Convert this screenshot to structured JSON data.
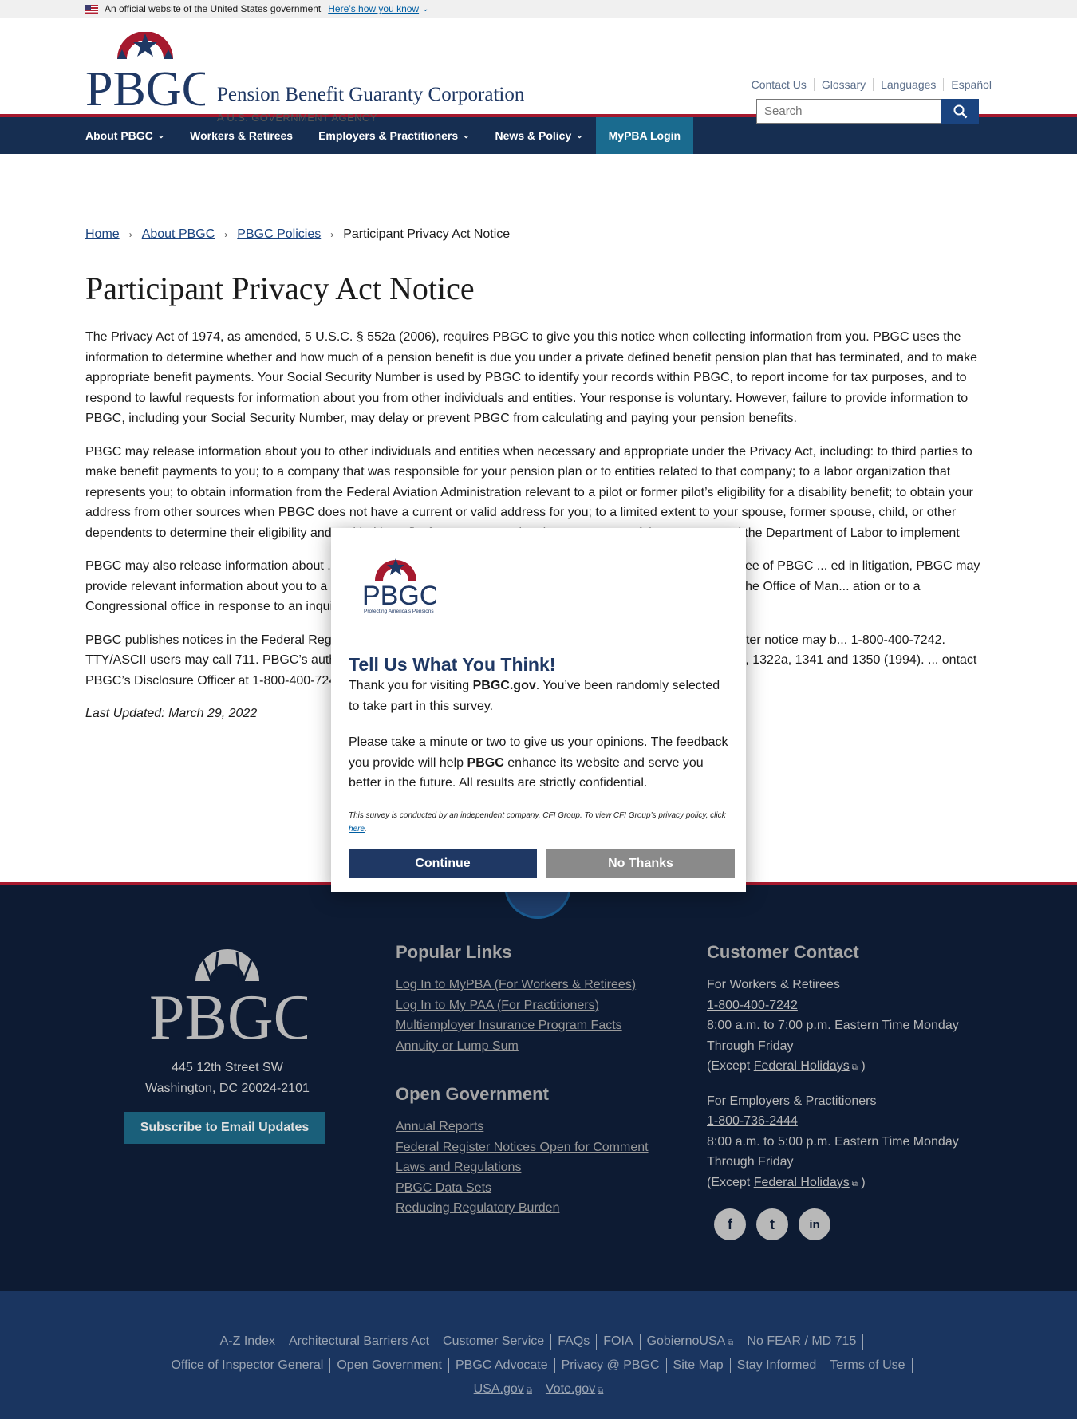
{
  "gov_banner": {
    "text": "An official website of the United States government",
    "how_link": "Here’s how you know"
  },
  "header": {
    "agency_name": "Pension Benefit Guaranty Corporation",
    "agency_sub": "A U.S. GOVERNMENT AGENCY",
    "util_links": [
      "Contact Us",
      "Glossary",
      "Languages",
      "Español"
    ],
    "search_placeholder": "Search"
  },
  "nav": {
    "items": [
      {
        "label": "About PBGC",
        "dropdown": true
      },
      {
        "label": "Workers & Retirees",
        "dropdown": false
      },
      {
        "label": "Employers & Practitioners",
        "dropdown": true
      },
      {
        "label": "News & Policy",
        "dropdown": true
      },
      {
        "label": "MyPBA Login",
        "dropdown": false
      }
    ]
  },
  "breadcrumb": [
    "Home",
    "About PBGC",
    "PBGC Policies",
    "Participant Privacy Act Notice"
  ],
  "page": {
    "title": "Participant Privacy Act Notice",
    "paragraphs": [
      "The Privacy Act of 1974, as amended, 5 U.S.C. § 552a (2006), requires PBGC to give you this notice when collecting information from you. PBGC uses the information to determine whether and how much of a pension benefit is due you under a private defined benefit pension plan that has terminated, and to make appropriate benefit payments. Your Social Security Number is used by PBGC to identify your records within PBGC, to report income for tax purposes, and to respond to lawful requests for information about you from other individuals and entities. Your response is voluntary. However, failure to provide information to PBGC, including your Social Security Number, may delay or prevent PBGC from calculating and paying your pension benefits.",
      "PBGC may release information about you to other individuals and entities when necessary and appropriate under the Privacy Act, including: to third parties to make benefit payments to you; to a company that was responsible for your pension plan or to entities related to that company; to a labor organization that represents you; to obtain information from the Federal Aviation Administration relevant to a pilot or former pilot’s eligibility for a disability benefit; to obtain your address from other sources when PBGC does not have a current or valid address for you; to a limited extent to your spouse, former spouse, child, or other dependents to determine their eligibility and entitled benefits from PBGC; and to the Department of the Treasury and the Department of Labor to implement",
      "PBGC may also release information about ... aware of a possible violation of civil or criminal law. If PBGC, an employee of PBGC ... ed in litigation, PBGC may provide relevant information about you to a court ... esents PBGC. PBGC may also provide information about you to the Office of Man... ation or to a Congressional office in response to an inquiry that office makes a",
      "PBGC publishes notices in the Federal Register ... made available to others. A copy of the most recent Federal Register notice may b... 1-800-400-7242. TTY/ASCII users may call 711. PBGC’s authority to collect inform... 29 U.S.C. §§ 1055, 1056(d)(3), 1302, 1321, 1322, 1322a, 1341 and 1350 (1994). ... ontact PBGC’s Disclosure Officer at 1-800-400-7242 extension 4040."
    ],
    "last_updated": "Last Updated: March 29, 2022"
  },
  "footer": {
    "address_line1": "445 12th Street SW",
    "address_line2": "Washington, DC 20024-2101",
    "subscribe": "Subscribe to Email Updates",
    "popular_links_title": "Popular Links",
    "popular_links": [
      "Log In to MyPBA (For Workers & Retirees)",
      "Log In to My PAA (For Practitioners)",
      "Multiemployer Insurance Program Facts",
      "Annuity or Lump Sum"
    ],
    "open_gov_title": "Open Government",
    "open_gov_links": [
      "Annual Reports",
      "Federal Register Notices Open for Comment",
      "Laws and Regulations",
      "PBGC Data Sets",
      "Reducing Regulatory Burden"
    ],
    "contact_title": "Customer Contact",
    "contact_workers_label": "For Workers & Retirees",
    "contact_workers_phone": "1-800-400-7242",
    "contact_workers_hours": "8:00 a.m. to 7:00 p.m. Eastern Time Monday Through Friday",
    "contact_employers_label": "For Employers & Practitioners",
    "contact_employers_phone": "1-800-736-2444",
    "contact_employers_hours": "8:00 a.m. to 5:00 p.m. Eastern Time Monday Through Friday",
    "except_prefix": "(Except ",
    "except_link": "Federal Holidays",
    "except_suffix": " )",
    "social": [
      {
        "name": "facebook-icon",
        "glyph": "f"
      },
      {
        "name": "twitter-icon",
        "glyph": "t"
      },
      {
        "name": "linkedin-icon",
        "glyph": "in"
      }
    ]
  },
  "bottom_links": {
    "row1": [
      "A-Z Index",
      "Architectural Barriers Act",
      "Customer Service",
      "FAQs",
      "FOIA",
      "GobiernoUSA",
      "No FEAR / MD 715"
    ],
    "row2": [
      "Office of Inspector General",
      "Open Government",
      "PBGC Advocate",
      "Privacy @ PBGC",
      "Site Map",
      "Stay Informed",
      "Terms of Use"
    ],
    "row3": [
      "USA.gov",
      "Vote.gov"
    ]
  },
  "modal": {
    "logo_tagline": "Protecting America’s Pensions",
    "title": "Tell Us What You Think!",
    "body1_pre": "Thank you for visiting ",
    "body1_bold": "PBGC.gov",
    "body1_post": ". You’ve been randomly selected to take part in this survey.",
    "body2_pre": "Please take a minute or two to give us your opinions. The feedback you provide will help ",
    "body2_bold": "PBGC",
    "body2_post": " enhance its website and serve you better in the future. All results are strictly confidential.",
    "fine_print": "This survey is conducted by an independent company, CFI Group. To view CFI Group’s privacy policy, click ",
    "fine_link": "here",
    "fine_end": ".",
    "continue_label": "Continue",
    "no_thanks_label": "No Thanks"
  },
  "colors": {
    "navy": "#162e51",
    "brand_red": "#a6192e",
    "link_blue": "#1a4480",
    "modal_title": "#1f3864",
    "footer_bg": "#0d1b33",
    "bottom_bg": "#1a3560"
  }
}
